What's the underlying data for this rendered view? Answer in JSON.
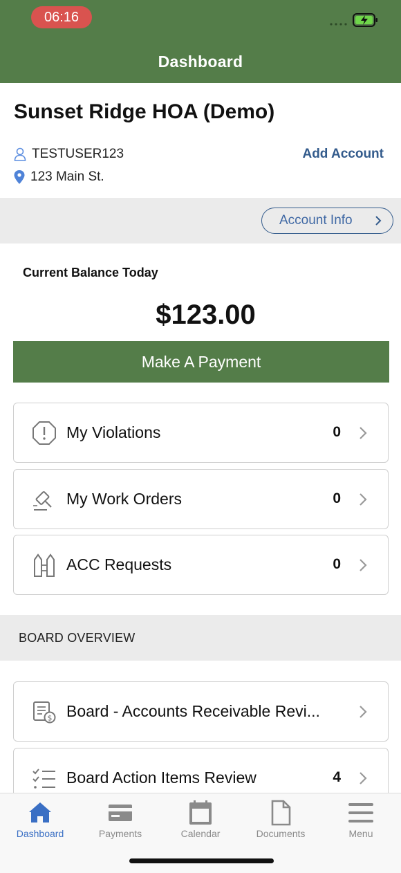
{
  "status": {
    "time": "06:16"
  },
  "header": {
    "title": "Dashboard"
  },
  "account": {
    "name": "Sunset Ridge HOA (Demo)",
    "username": "TESTUSER123",
    "address": "123 Main St.",
    "add_account_label": "Add Account",
    "account_info_label": "Account Info"
  },
  "balance": {
    "label": "Current Balance Today",
    "value": "$123.00",
    "pay_button_label": "Make A Payment"
  },
  "items": [
    {
      "label": "My Violations",
      "count": "0",
      "icon": "alert-octagon-icon"
    },
    {
      "label": "My Work Orders",
      "count": "0",
      "icon": "gavel-icon"
    },
    {
      "label": "ACC Requests",
      "count": "0",
      "icon": "building-icon"
    }
  ],
  "board": {
    "title": "BOARD OVERVIEW",
    "items": [
      {
        "label": "Board - Accounts Receivable Revi...",
        "count": "",
        "icon": "ledger-dollar-icon"
      },
      {
        "label": "Board Action Items Review",
        "count": "4",
        "icon": "checklist-icon"
      }
    ]
  },
  "tabs": [
    {
      "label": "Dashboard",
      "icon": "home-icon",
      "active": true
    },
    {
      "label": "Payments",
      "icon": "credit-card-icon",
      "active": false
    },
    {
      "label": "Calendar",
      "icon": "calendar-icon",
      "active": false
    },
    {
      "label": "Documents",
      "icon": "document-icon",
      "active": false
    },
    {
      "label": "Menu",
      "icon": "menu-icon",
      "active": false
    }
  ],
  "colors": {
    "brand_green": "#547d49",
    "link_blue": "#335b8c",
    "active_tab": "#3a6fc4"
  }
}
